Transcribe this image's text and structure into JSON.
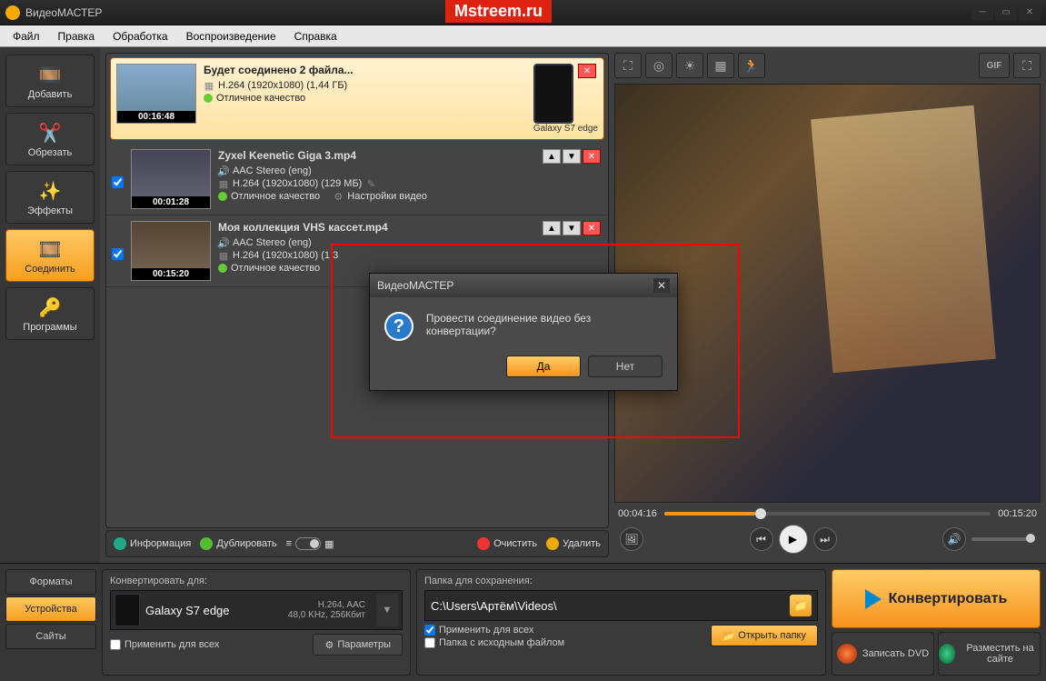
{
  "window": {
    "title": "ВидеоМАСТЕР"
  },
  "watermark": "Mstreem.ru",
  "menu": {
    "file": "Файл",
    "edit": "Правка",
    "process": "Обработка",
    "play": "Воспроизведение",
    "help": "Справка"
  },
  "sidebar": {
    "add": "Добавить",
    "cut": "Обрезать",
    "effects": "Эффекты",
    "join": "Соединить",
    "programs": "Программы"
  },
  "files": [
    {
      "title": "Будет соединено 2 файла...",
      "codec": "H.264 (1920x1080) (1,44 ГБ)",
      "quality": "Отличное качество",
      "duration": "00:16:48",
      "device": "Galaxy S7 edge"
    },
    {
      "title": "Zyxel Keenetic Giga 3.mp4",
      "audio": "AAC Stereo (eng)",
      "codec": "H.264 (1920x1080) (129 МБ)",
      "quality": "Отличное качество",
      "settings": "Настройки видео",
      "duration": "00:01:28"
    },
    {
      "title": "Моя коллекция VHS кассет.mp4",
      "audio": "AAC Stereo (eng)",
      "codec": "H.264 (1920x1080) (1,3",
      "quality": "Отличное качество",
      "duration": "00:15:20"
    }
  ],
  "listbar": {
    "info": "Информация",
    "dup": "Дублировать",
    "clear": "Очистить",
    "delete": "Удалить"
  },
  "playback": {
    "current": "00:04:16",
    "total": "00:15:20"
  },
  "bottom": {
    "tabs": {
      "formats": "Форматы",
      "devices": "Устройства",
      "sites": "Сайты"
    },
    "convertFor": "Конвертировать для:",
    "device": "Galaxy S7 edge",
    "deviceInfo1": "H.264, AAC",
    "deviceInfo2": "48,0 KHz, 256Кбит",
    "applyAll": "Применить для всех",
    "params": "Параметры",
    "saveFolder": "Папка для сохранения:",
    "path": "C:\\Users\\Артём\\Videos\\",
    "sourceFolder": "Папка с исходным файлом",
    "openFolder": "Открыть папку",
    "convert": "Конвертировать",
    "burnDVD": "Записать DVD",
    "upload": "Разместить на сайте"
  },
  "dialog": {
    "title": "ВидеоМАСТЕР",
    "message": "Провести соединение видео без конвертации?",
    "yes": "Да",
    "no": "Нет"
  }
}
